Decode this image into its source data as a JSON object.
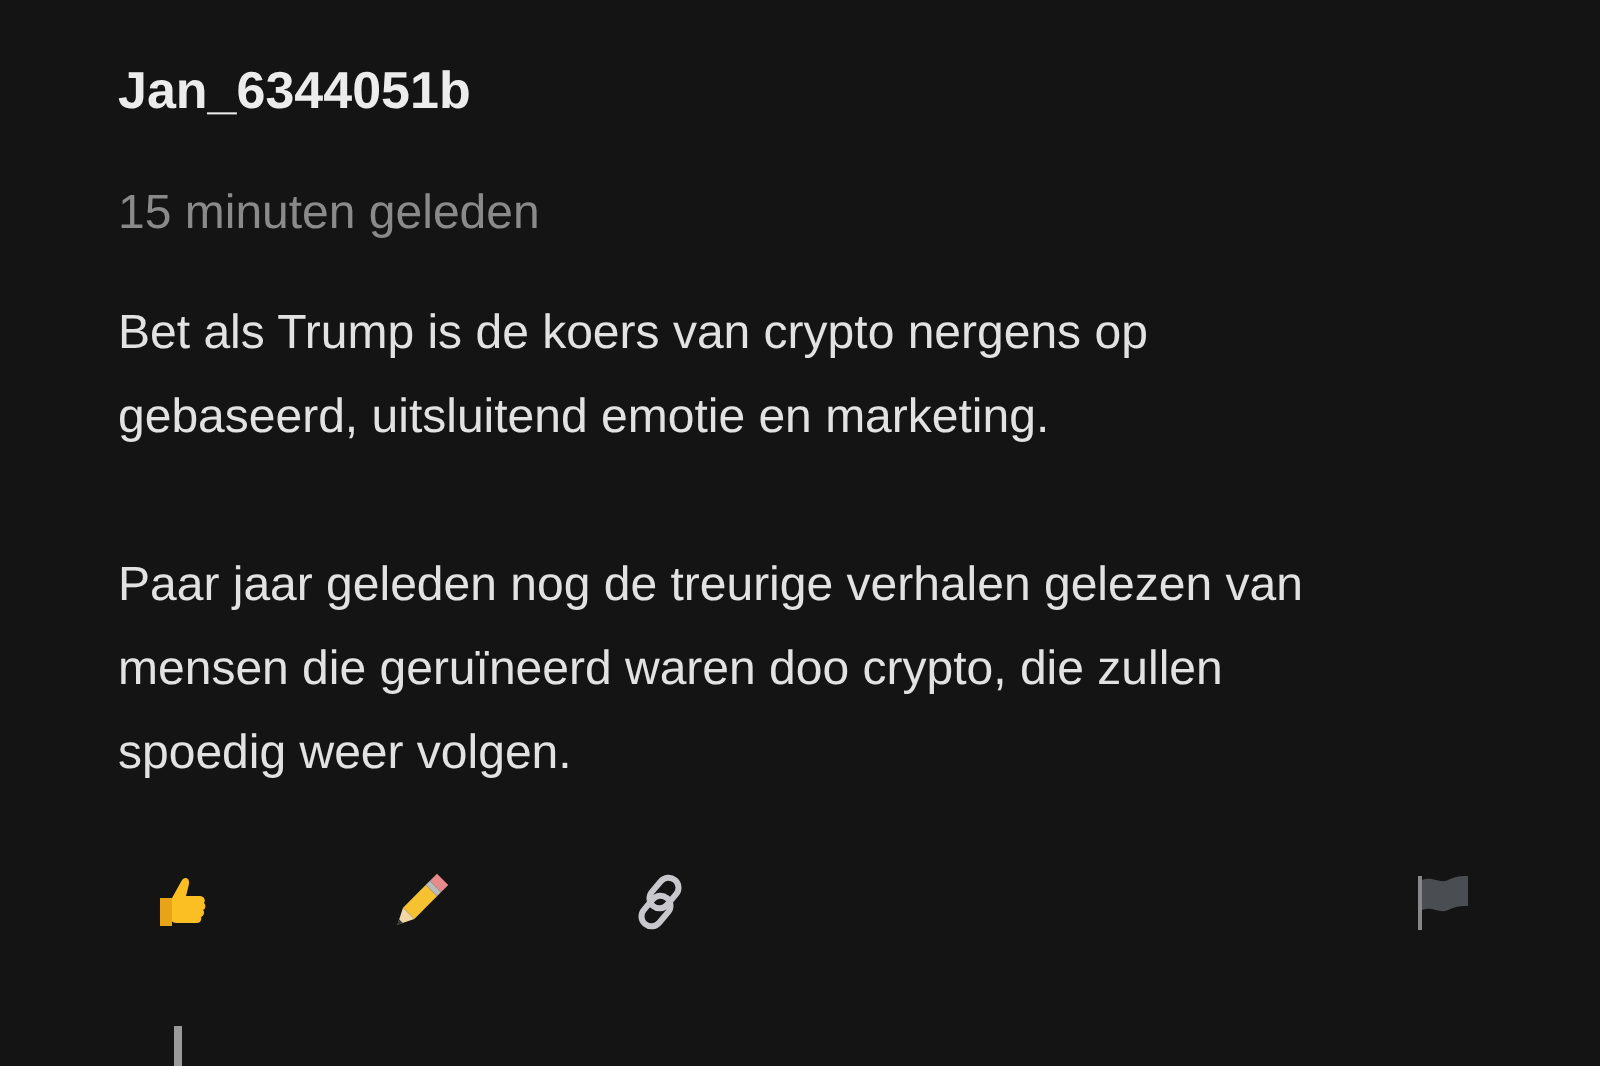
{
  "comment": {
    "author": "Jan_6344051b",
    "time": "15 minuten geleden",
    "paragraphs": [
      "Bet als Trump is de koers van crypto nergens op gebaseerd, uitsluitend emotie en marketing.",
      "Paar jaar geleden nog de treurige verhalen gelezen van mensen die geruïneerd waren doo crypto, die zullen spoedig weer volgen."
    ],
    "actions": [
      {
        "kind": "like"
      },
      {
        "kind": "edit"
      },
      {
        "kind": "link"
      },
      {
        "kind": "report"
      }
    ]
  }
}
